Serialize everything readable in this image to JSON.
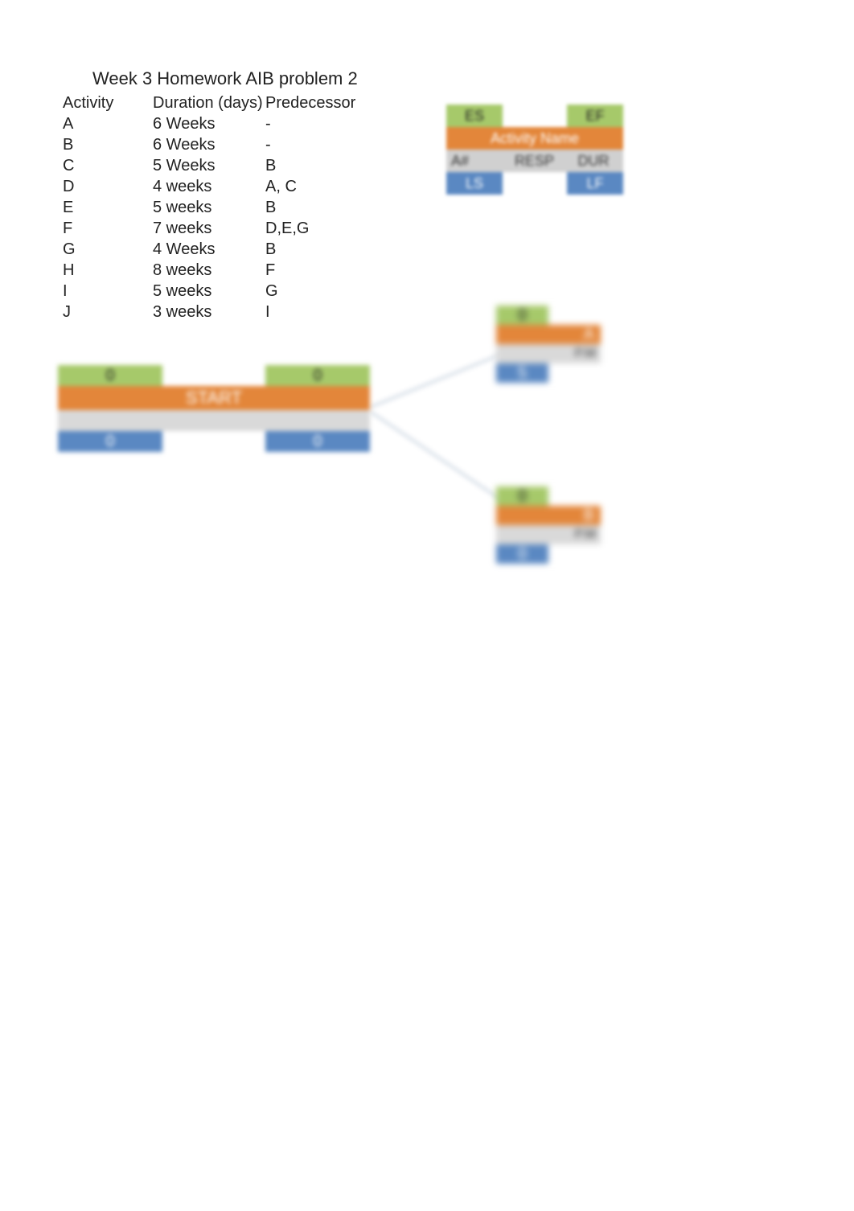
{
  "title": "Week 3 Homework AIB problem 2",
  "table": {
    "headers": {
      "c1": "Activity",
      "c2": "Duration (days)",
      "c3": "Predecessor"
    },
    "rows": [
      {
        "c1": "A",
        "c2": "6 Weeks",
        "c3": "-"
      },
      {
        "c1": "B",
        "c2": "6 Weeks",
        "c3": "-"
      },
      {
        "c1": "C",
        "c2": "5 Weeks",
        "c3": "B"
      },
      {
        "c1": "D",
        "c2": "4 weeks",
        "c3": "A, C"
      },
      {
        "c1": "E",
        "c2": "5 weeks",
        "c3": "B"
      },
      {
        "c1": "F",
        "c2": "7 weeks",
        "c3": "D,E,G"
      },
      {
        "c1": "G",
        "c2": "4 Weeks",
        "c3": "B"
      },
      {
        "c1": "H",
        "c2": "8 weeks",
        "c3": "F"
      },
      {
        "c1": "I",
        "c2": "5 weeks",
        "c3": "G"
      },
      {
        "c1": "J",
        "c2": "3 weeks",
        "c3": "I"
      }
    ]
  },
  "legend": {
    "es": "ES",
    "ef": "EF",
    "name": "Activity Name",
    "anum": "A#",
    "resp": "RESP",
    "dur": "DUR",
    "ls": "LS",
    "lf": "LF"
  },
  "start": {
    "es": "0",
    "ef": "0",
    "name": "START",
    "ls": "0",
    "lf": "0"
  },
  "nodeA": {
    "es": "0",
    "name": "A",
    "resp": "P.M",
    "ls": "5"
  },
  "nodeB": {
    "es": "0",
    "name": "B",
    "resp": "P.M",
    "ls": "0"
  }
}
